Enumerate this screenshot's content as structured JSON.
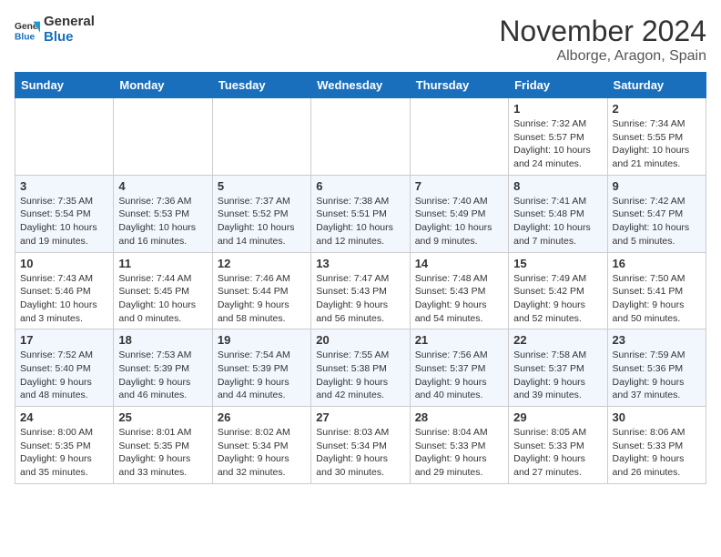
{
  "header": {
    "logo_line1": "General",
    "logo_line2": "Blue",
    "month_title": "November 2024",
    "location": "Alborge, Aragon, Spain"
  },
  "days_of_week": [
    "Sunday",
    "Monday",
    "Tuesday",
    "Wednesday",
    "Thursday",
    "Friday",
    "Saturday"
  ],
  "weeks": [
    [
      {
        "day": "",
        "info": ""
      },
      {
        "day": "",
        "info": ""
      },
      {
        "day": "",
        "info": ""
      },
      {
        "day": "",
        "info": ""
      },
      {
        "day": "",
        "info": ""
      },
      {
        "day": "1",
        "info": "Sunrise: 7:32 AM\nSunset: 5:57 PM\nDaylight: 10 hours and 24 minutes."
      },
      {
        "day": "2",
        "info": "Sunrise: 7:34 AM\nSunset: 5:55 PM\nDaylight: 10 hours and 21 minutes."
      }
    ],
    [
      {
        "day": "3",
        "info": "Sunrise: 7:35 AM\nSunset: 5:54 PM\nDaylight: 10 hours and 19 minutes."
      },
      {
        "day": "4",
        "info": "Sunrise: 7:36 AM\nSunset: 5:53 PM\nDaylight: 10 hours and 16 minutes."
      },
      {
        "day": "5",
        "info": "Sunrise: 7:37 AM\nSunset: 5:52 PM\nDaylight: 10 hours and 14 minutes."
      },
      {
        "day": "6",
        "info": "Sunrise: 7:38 AM\nSunset: 5:51 PM\nDaylight: 10 hours and 12 minutes."
      },
      {
        "day": "7",
        "info": "Sunrise: 7:40 AM\nSunset: 5:49 PM\nDaylight: 10 hours and 9 minutes."
      },
      {
        "day": "8",
        "info": "Sunrise: 7:41 AM\nSunset: 5:48 PM\nDaylight: 10 hours and 7 minutes."
      },
      {
        "day": "9",
        "info": "Sunrise: 7:42 AM\nSunset: 5:47 PM\nDaylight: 10 hours and 5 minutes."
      }
    ],
    [
      {
        "day": "10",
        "info": "Sunrise: 7:43 AM\nSunset: 5:46 PM\nDaylight: 10 hours and 3 minutes."
      },
      {
        "day": "11",
        "info": "Sunrise: 7:44 AM\nSunset: 5:45 PM\nDaylight: 10 hours and 0 minutes."
      },
      {
        "day": "12",
        "info": "Sunrise: 7:46 AM\nSunset: 5:44 PM\nDaylight: 9 hours and 58 minutes."
      },
      {
        "day": "13",
        "info": "Sunrise: 7:47 AM\nSunset: 5:43 PM\nDaylight: 9 hours and 56 minutes."
      },
      {
        "day": "14",
        "info": "Sunrise: 7:48 AM\nSunset: 5:43 PM\nDaylight: 9 hours and 54 minutes."
      },
      {
        "day": "15",
        "info": "Sunrise: 7:49 AM\nSunset: 5:42 PM\nDaylight: 9 hours and 52 minutes."
      },
      {
        "day": "16",
        "info": "Sunrise: 7:50 AM\nSunset: 5:41 PM\nDaylight: 9 hours and 50 minutes."
      }
    ],
    [
      {
        "day": "17",
        "info": "Sunrise: 7:52 AM\nSunset: 5:40 PM\nDaylight: 9 hours and 48 minutes."
      },
      {
        "day": "18",
        "info": "Sunrise: 7:53 AM\nSunset: 5:39 PM\nDaylight: 9 hours and 46 minutes."
      },
      {
        "day": "19",
        "info": "Sunrise: 7:54 AM\nSunset: 5:39 PM\nDaylight: 9 hours and 44 minutes."
      },
      {
        "day": "20",
        "info": "Sunrise: 7:55 AM\nSunset: 5:38 PM\nDaylight: 9 hours and 42 minutes."
      },
      {
        "day": "21",
        "info": "Sunrise: 7:56 AM\nSunset: 5:37 PM\nDaylight: 9 hours and 40 minutes."
      },
      {
        "day": "22",
        "info": "Sunrise: 7:58 AM\nSunset: 5:37 PM\nDaylight: 9 hours and 39 minutes."
      },
      {
        "day": "23",
        "info": "Sunrise: 7:59 AM\nSunset: 5:36 PM\nDaylight: 9 hours and 37 minutes."
      }
    ],
    [
      {
        "day": "24",
        "info": "Sunrise: 8:00 AM\nSunset: 5:35 PM\nDaylight: 9 hours and 35 minutes."
      },
      {
        "day": "25",
        "info": "Sunrise: 8:01 AM\nSunset: 5:35 PM\nDaylight: 9 hours and 33 minutes."
      },
      {
        "day": "26",
        "info": "Sunrise: 8:02 AM\nSunset: 5:34 PM\nDaylight: 9 hours and 32 minutes."
      },
      {
        "day": "27",
        "info": "Sunrise: 8:03 AM\nSunset: 5:34 PM\nDaylight: 9 hours and 30 minutes."
      },
      {
        "day": "28",
        "info": "Sunrise: 8:04 AM\nSunset: 5:33 PM\nDaylight: 9 hours and 29 minutes."
      },
      {
        "day": "29",
        "info": "Sunrise: 8:05 AM\nSunset: 5:33 PM\nDaylight: 9 hours and 27 minutes."
      },
      {
        "day": "30",
        "info": "Sunrise: 8:06 AM\nSunset: 5:33 PM\nDaylight: 9 hours and 26 minutes."
      }
    ]
  ]
}
